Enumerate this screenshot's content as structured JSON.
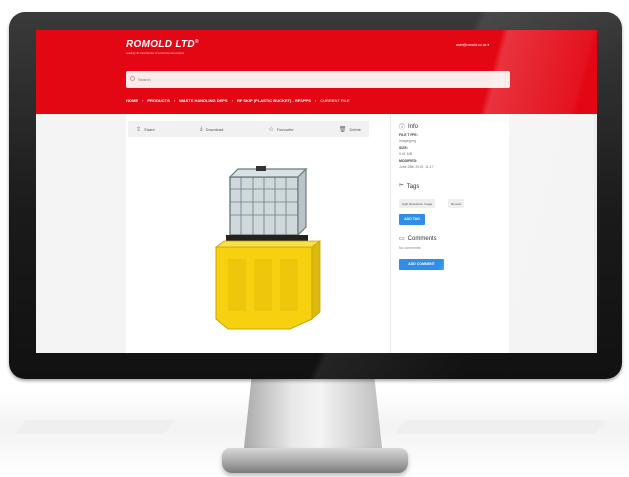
{
  "app": {
    "brand": "ROMOLD LTD",
    "brand_mark": "®",
    "tagline": "Leading UK manufacturer of environmental products",
    "user_menu": "user@romold.co.uk ▾"
  },
  "search": {
    "placeholder": "Search"
  },
  "breadcrumb": [
    "HOME",
    "PRODUCTS",
    "WASTE HANDLING DEPS",
    "RF SKIP (PLASTIC BUCKET) - RFSPPS",
    "CURRENT FILE"
  ],
  "toolbar": {
    "share": "Share",
    "download": "Download",
    "favourite": "Favourite",
    "delete": "Delete"
  },
  "info": {
    "title": "Info",
    "file_type_label": "FILE TYPE:",
    "file_type": "image/jpeg",
    "size_label": "SIZE:",
    "size": "0.41 MB",
    "modified_label": "MODIFIED:",
    "modified": "June 28th 2019, 11:17"
  },
  "tags": {
    "title": "Tags",
    "items": [
      "High Resolution Image",
      "Romold"
    ],
    "add_label": "ADD TAG"
  },
  "comments": {
    "title": "Comments",
    "empty": "No comments",
    "add_label": "ADD COMMENT"
  },
  "colors": {
    "brand_red": "#e30613",
    "button_blue": "#2f8ee6",
    "tank_yellow": "#f6d110"
  }
}
